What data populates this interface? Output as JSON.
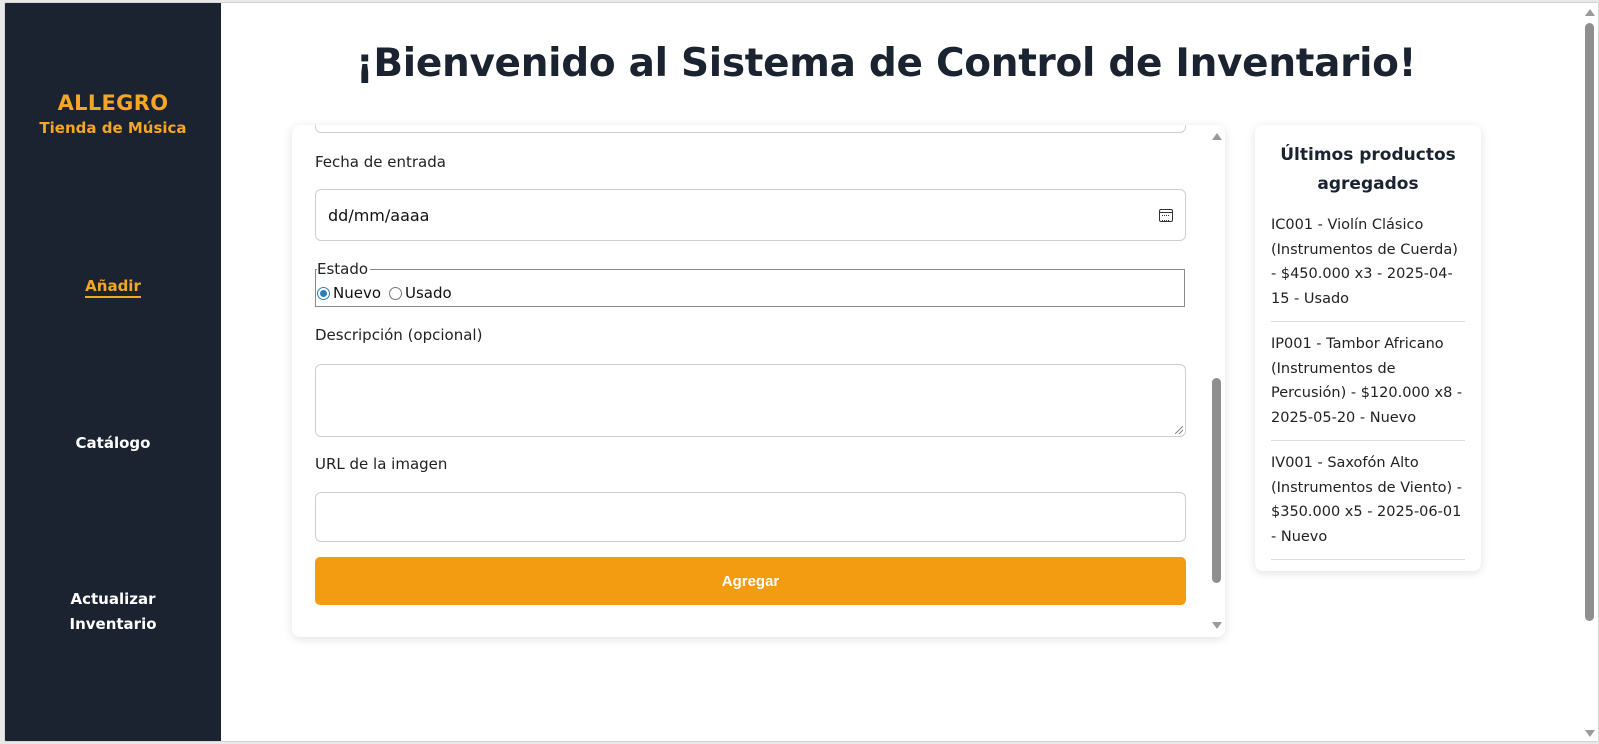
{
  "brand": {
    "name": "ALLEGRO",
    "subtitle": "Tienda de Música",
    "accent_color": "#f5a623"
  },
  "sidebar": {
    "items": [
      {
        "label": "Añadir",
        "active": true
      },
      {
        "label": "Catálogo",
        "active": false
      },
      {
        "label": "Actualizar Inventario",
        "active": false
      }
    ]
  },
  "main": {
    "title": "¡Bienvenido al Sistema de Control de Inventario!"
  },
  "form": {
    "date_label": "Fecha de entrada",
    "date_placeholder": "dd/mm/aaaa",
    "state_legend": "Estado",
    "state_options": [
      {
        "label": "Nuevo",
        "selected": true
      },
      {
        "label": "Usado",
        "selected": false
      }
    ],
    "description_label": "Descripción (opcional)",
    "description_value": "",
    "image_url_label": "URL de la imagen",
    "image_url_value": "",
    "submit_label": "Agregar",
    "submit_color": "#f39c12"
  },
  "recent": {
    "title": "Últimos productos agregados",
    "items": [
      "IC001 - Violín Clásico (Instrumentos de Cuerda) - $450.000 x3 - 2025-04-15 - Usado",
      "IP001 - Tambor Africano (Instrumentos de Percusión) - $120.000 x8 - 2025-05-20 - Nuevo",
      "IV001 - Saxofón Alto (Instrumentos de Viento) - $350.000 x5 - 2025-06-01 - Nuevo"
    ]
  },
  "icons": {
    "calendar": "calendar-icon"
  }
}
